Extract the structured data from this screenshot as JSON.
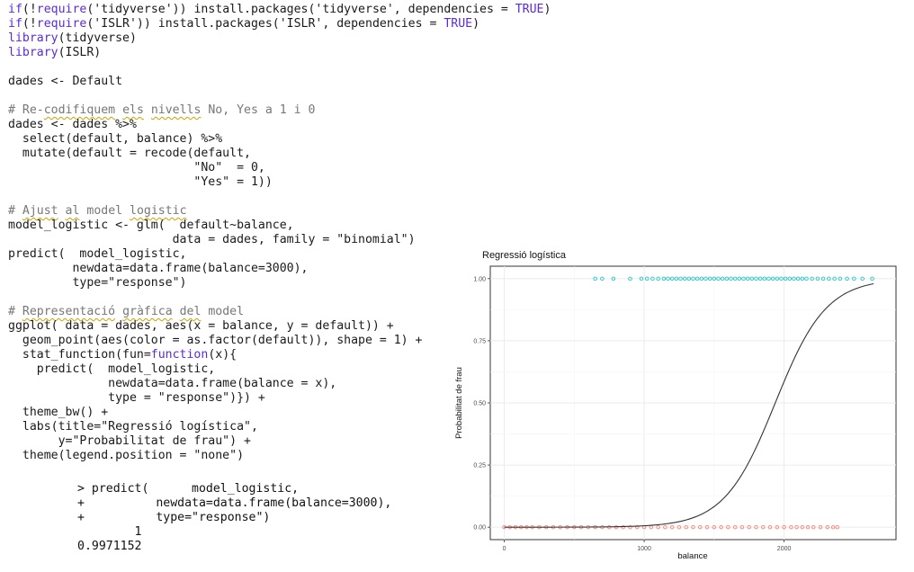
{
  "script": {
    "lines": [
      [
        [
          "kw",
          "if"
        ],
        [
          "t",
          "(!"
        ],
        [
          "kw",
          "require"
        ],
        [
          "t",
          "('tidyverse')) install.packages('tidyverse', dependencies = "
        ],
        [
          "kw",
          "TRUE"
        ],
        [
          "t",
          ")"
        ]
      ],
      [
        [
          "kw",
          "if"
        ],
        [
          "t",
          "(!"
        ],
        [
          "kw",
          "require"
        ],
        [
          "t",
          "('ISLR')) install.packages('ISLR', dependencies = "
        ],
        [
          "kw",
          "TRUE"
        ],
        [
          "t",
          ")"
        ]
      ],
      [
        [
          "kw",
          "library"
        ],
        [
          "t",
          "(tidyverse)"
        ]
      ],
      [
        [
          "kw",
          "library"
        ],
        [
          "t",
          "(ISLR)"
        ]
      ],
      [],
      [
        [
          "t",
          "dades <- Default"
        ]
      ],
      [],
      [
        [
          "cm",
          "# Re-"
        ],
        [
          "cmsq",
          "codifiquem"
        ],
        [
          "cm",
          " "
        ],
        [
          "cmsq",
          "els"
        ],
        [
          "cm",
          " "
        ],
        [
          "cmsq",
          "nivells"
        ],
        [
          "cm",
          " No, Yes a 1 i 0"
        ]
      ],
      [
        [
          "t",
          "dades <- dades %>%"
        ]
      ],
      [
        [
          "t",
          "  select(default, balance) %>%"
        ]
      ],
      [
        [
          "t",
          "  mutate(default = recode(default,"
        ]
      ],
      [
        [
          "t",
          "                          \"No\"  = 0,"
        ]
      ],
      [
        [
          "t",
          "                          \"Yes\" = 1))"
        ]
      ],
      [],
      [
        [
          "cm",
          "# "
        ],
        [
          "cmsq",
          "Ajust"
        ],
        [
          "cm",
          " "
        ],
        [
          "cmsq",
          "al"
        ],
        [
          "cm",
          " model "
        ],
        [
          "cmsq",
          "logistic"
        ]
      ],
      [
        [
          "t",
          "model_logistic <- glm(  default~balance,"
        ]
      ],
      [
        [
          "t",
          "                       data = dades, family = \"binomial\")"
        ]
      ],
      [
        [
          "t",
          "predict(  model_logistic,"
        ]
      ],
      [
        [
          "t",
          "         newdata=data.frame(balance=3000),"
        ]
      ],
      [
        [
          "t",
          "         type=\"response\")"
        ]
      ],
      [],
      [
        [
          "cm",
          "# "
        ],
        [
          "cmsq",
          "Representació"
        ],
        [
          "cm",
          " "
        ],
        [
          "cmsq",
          "gràfica"
        ],
        [
          "cm",
          " "
        ],
        [
          "cmsq",
          "del"
        ],
        [
          "cm",
          " model"
        ]
      ],
      [
        [
          "t",
          "ggplot( data = dades, aes(x = balance, y = default)) +"
        ]
      ],
      [
        [
          "t",
          "  geom_point(aes(color = as.factor(default)), shape = 1) +"
        ]
      ],
      [
        [
          "t",
          "  stat_function(fun="
        ],
        [
          "kw",
          "function"
        ],
        [
          "t",
          "(x){"
        ]
      ],
      [
        [
          "t",
          "    predict(  model_logistic,"
        ]
      ],
      [
        [
          "t",
          "              newdata=data.frame(balance = x),"
        ]
      ],
      [
        [
          "t",
          "              type = \"response\")}) +"
        ]
      ],
      [
        [
          "t",
          "  theme_bw() +"
        ]
      ],
      [
        [
          "t",
          "  labs(title=\"Regressió logística\","
        ]
      ],
      [
        [
          "t",
          "       y=\"Probabilitat de frau\") +"
        ]
      ],
      [
        [
          "t",
          "  theme(legend.position = \"none\")"
        ]
      ]
    ]
  },
  "console": {
    "lines": [
      "> predict(      model_logistic,",
      "+          newdata=data.frame(balance=3000),",
      "+          type=\"response\")",
      "        1",
      "0.9971152"
    ]
  },
  "chart_data": {
    "type": "scatter",
    "title": "Regressió logística",
    "xlabel": "balance",
    "ylabel": "Probabilitat de frau",
    "xlim": [
      -100,
      2800
    ],
    "ylim": [
      -0.05,
      1.05
    ],
    "xticks": [
      0,
      1000,
      2000
    ],
    "xtick_labels": [
      "0",
      "1000",
      "2000"
    ],
    "yticks": [
      0,
      0.25,
      0.5,
      0.75,
      1
    ],
    "ytick_labels": [
      "0.00",
      "0.25",
      "0.50",
      "0.75",
      "1.00"
    ],
    "grid": true,
    "legend": "none",
    "series": [
      {
        "values_y": 1,
        "color": "#00BFC4",
        "x": [
          650,
          700,
          780,
          900,
          980,
          1020,
          1060,
          1100,
          1140,
          1170,
          1200,
          1230,
          1260,
          1290,
          1320,
          1350,
          1380,
          1410,
          1440,
          1470,
          1500,
          1530,
          1560,
          1590,
          1620,
          1650,
          1680,
          1710,
          1740,
          1770,
          1800,
          1830,
          1860,
          1890,
          1920,
          1950,
          1980,
          2010,
          2040,
          2070,
          2100,
          2130,
          2160,
          2200,
          2240,
          2280,
          2320,
          2360,
          2400,
          2450,
          2500,
          2560,
          2630
        ]
      },
      {
        "values_y": 0,
        "color": "#F8766D",
        "x": [
          0,
          40,
          80,
          120,
          160,
          200,
          250,
          300,
          350,
          400,
          450,
          500,
          550,
          600,
          650,
          700,
          750,
          800,
          850,
          900,
          950,
          1000,
          1050,
          1100,
          1150,
          1200,
          1250,
          1300,
          1350,
          1400,
          1450,
          1500,
          1550,
          1600,
          1650,
          1700,
          1750,
          1800,
          1850,
          1900,
          1950,
          2000,
          2050,
          2090,
          2130,
          2170,
          2210,
          2260,
          2310,
          2350,
          2380
        ]
      }
    ],
    "curve": {
      "color": "#333333",
      "intercept": -10.6513,
      "slope": 0.005499,
      "x_range": [
        0,
        2654
      ]
    }
  }
}
